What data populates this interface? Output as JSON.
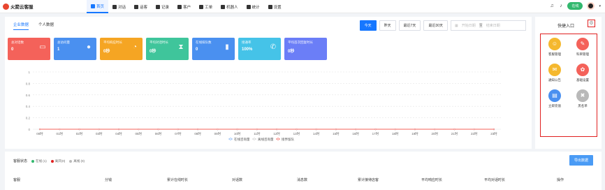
{
  "app": {
    "title": "火箭云客服"
  },
  "nav": [
    {
      "label": "首页",
      "icon": "home-icon",
      "active": true
    },
    {
      "label": "对话",
      "icon": "chat-icon"
    },
    {
      "label": "话客",
      "icon": "tag-icon"
    },
    {
      "label": "记录",
      "icon": "record-icon"
    },
    {
      "label": "客户",
      "icon": "user-icon"
    },
    {
      "label": "工单",
      "icon": "ticket-icon"
    },
    {
      "label": "机器人",
      "icon": "robot-icon"
    },
    {
      "label": "统计",
      "icon": "stats-icon"
    },
    {
      "label": "设置",
      "icon": "gear-icon"
    }
  ],
  "header": {
    "status": "在线"
  },
  "tabs": [
    {
      "label": "企业数据",
      "active": true
    },
    {
      "label": "个人数据"
    }
  ],
  "range": {
    "today": "今天",
    "yesterday": "昨天",
    "last7": "最近7天",
    "last30": "最近30天",
    "start_placeholder": "开始日期",
    "separator": "至",
    "end_placeholder": "结束日期"
  },
  "cards": [
    {
      "label": "总对话数",
      "value": "0",
      "color": "#f4625a",
      "icon": "chat-card-icon",
      "glyph": "▭"
    },
    {
      "label": "总访问量",
      "value": "1",
      "color": "#4a90f0",
      "icon": "visitor-card-icon",
      "glyph": "●"
    },
    {
      "label": "平均响应时长",
      "value": "0秒",
      "color": "#f5a523",
      "icon": "clock-card-icon",
      "glyph": "◔"
    },
    {
      "label": "平均对话时长",
      "value": "0秒",
      "color": "#3fc59b",
      "icon": "hourglass-card-icon",
      "glyph": "⧗"
    },
    {
      "label": "在线排队数",
      "value": "0",
      "color": "#4a90f0",
      "icon": "bar-card-icon",
      "glyph": "▮"
    },
    {
      "label": "接通率",
      "value": "100%",
      "color": "#45c3e8",
      "icon": "phone-card-icon",
      "glyph": "✆"
    },
    {
      "label": "平均首次回复时长",
      "value": "0秒",
      "color": "#6b7ef7",
      "icon": "timer-card-icon",
      "glyph": ""
    }
  ],
  "chart_data": {
    "type": "line",
    "x": [
      "00时",
      "01时",
      "02时",
      "03时",
      "04时",
      "05时",
      "06时",
      "07时",
      "08时",
      "09时",
      "10时",
      "11时",
      "12时",
      "13时",
      "14时",
      "15时",
      "16时",
      "17时",
      "18时",
      "19时",
      "20时",
      "21时",
      "22时",
      "23时"
    ],
    "y_ticks": [
      "0",
      "0.2",
      "0.4",
      "0.6",
      "0.8",
      "1"
    ],
    "ylim": [
      0,
      1
    ],
    "series": [
      {
        "name": "在线咨询量",
        "color": "#7fb3f5",
        "values": [
          0,
          0,
          0,
          0,
          0,
          0,
          0,
          0,
          0,
          0,
          0,
          0,
          0,
          0,
          0,
          0,
          0,
          0,
          0,
          0,
          0,
          0,
          0,
          0
        ]
      },
      {
        "name": "离线咨询量",
        "color": "#cccccc",
        "values": [
          0,
          0,
          0,
          0,
          0,
          0,
          0,
          0,
          0,
          0,
          0,
          0,
          0,
          0,
          0,
          0,
          0,
          0,
          0,
          0,
          0,
          0,
          0,
          0
        ]
      },
      {
        "name": "接界留队",
        "color": "#f4625a",
        "values": [
          0,
          0,
          0,
          0,
          0,
          0,
          0,
          0,
          0,
          0,
          0,
          0,
          0,
          0,
          0,
          0,
          0,
          0,
          0,
          0,
          0,
          0,
          0,
          0
        ]
      }
    ],
    "grid": true,
    "legend": "bottom"
  },
  "quick": {
    "title": "快捷入口",
    "items": [
      {
        "label": "客服管理",
        "color": "#f5b82e",
        "icon": "agent-manage-icon",
        "glyph": "☺"
      },
      {
        "label": "科目管理",
        "color": "#f4625a",
        "icon": "subject-manage-icon",
        "glyph": "✎"
      },
      {
        "label": "通知公告",
        "color": "#f5b82e",
        "icon": "notice-icon",
        "glyph": "✉"
      },
      {
        "label": "基础设置",
        "color": "#f4625a",
        "icon": "basic-settings-icon",
        "glyph": "✿"
      },
      {
        "label": "立即充值",
        "color": "#4a90f0",
        "icon": "recharge-icon",
        "glyph": "▤"
      },
      {
        "label": "黑名单",
        "color": "#b9b9b9",
        "icon": "blacklist-icon",
        "glyph": "✖"
      }
    ]
  },
  "agents": {
    "title": "客服状态",
    "legend": [
      {
        "label": "在线 (1)",
        "color": "#33b86e"
      },
      {
        "label": "离开(0)",
        "color": "#e02020"
      },
      {
        "label": "离线 (0)",
        "color": "#bbbbbb"
      }
    ],
    "export": "导出数据",
    "columns": [
      "客服",
      "分钱",
      "累计在线时长",
      "对话数",
      "消息数",
      "累计接待店客",
      "平均响应时长",
      "平均对话时长",
      "操作"
    ]
  }
}
